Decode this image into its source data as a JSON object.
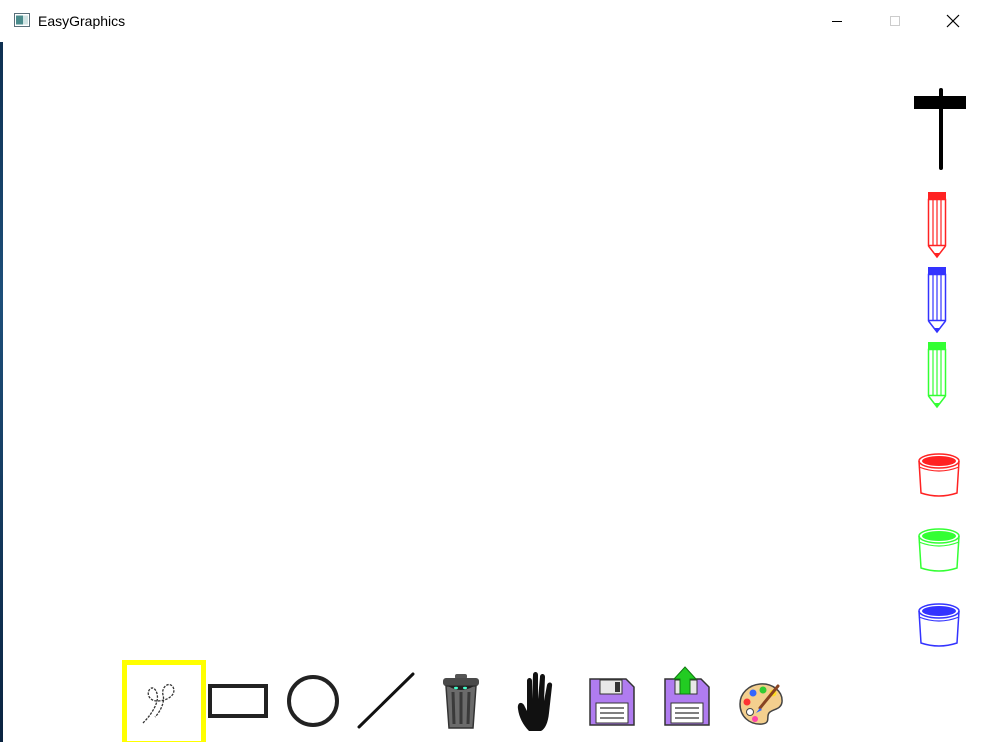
{
  "window": {
    "title": "EasyGraphics",
    "controls": {
      "minimize": "minimize",
      "maximize": "maximize",
      "close": "close"
    }
  },
  "colors": {
    "background": "#ffffff",
    "selection": "#ffff00",
    "red": "#ff2222",
    "blue": "#3333ff",
    "green": "#33ff33",
    "save_purple": "#b07cf0",
    "upload_green": "#22cc22"
  },
  "right_toolbar": [
    {
      "icon": "pen-width-icon",
      "color": "#000000"
    },
    {
      "icon": "pencil-icon",
      "color": "#ff2222"
    },
    {
      "icon": "pencil-icon",
      "color": "#3333ff"
    },
    {
      "icon": "pencil-icon",
      "color": "#33ff33"
    },
    {
      "icon": "paint-bucket-icon",
      "color": "#ff2222"
    },
    {
      "icon": "paint-bucket-icon",
      "color": "#33ff33"
    },
    {
      "icon": "paint-bucket-icon",
      "color": "#3333ff"
    }
  ],
  "bottom_toolbar": [
    {
      "icon": "freehand-icon",
      "selected": true
    },
    {
      "icon": "rectangle-icon",
      "selected": false
    },
    {
      "icon": "circle-icon",
      "selected": false
    },
    {
      "icon": "line-icon",
      "selected": false
    },
    {
      "icon": "trash-icon",
      "selected": false
    },
    {
      "icon": "hand-icon",
      "selected": false
    },
    {
      "icon": "save-icon",
      "selected": false
    },
    {
      "icon": "export-icon",
      "selected": false
    },
    {
      "icon": "palette-icon",
      "selected": false
    }
  ]
}
